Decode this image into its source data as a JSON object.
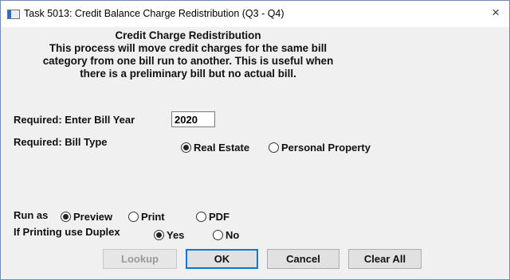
{
  "window": {
    "title": "Task 5013: Credit Balance Charge Redistribution (Q3 - Q4)",
    "close_glyph": "×",
    "icon": "app-window-icon"
  },
  "heading": {
    "title": "Credit Charge Redistribution",
    "lines": [
      "This process will move credit charges for the same bill",
      "category from one bill run to another.  This is useful when",
      "there is a preliminary bill but no actual bill."
    ]
  },
  "bill_year": {
    "label": "Required: Enter Bill Year",
    "value": "2020"
  },
  "bill_type": {
    "label": "Required: Bill Type",
    "options": [
      {
        "label": "Real Estate",
        "selected": true
      },
      {
        "label": "Personal Property",
        "selected": false
      }
    ]
  },
  "run_as": {
    "label": "Run as",
    "options": [
      {
        "label": "Preview",
        "selected": true
      },
      {
        "label": "Print",
        "selected": false
      },
      {
        "label": "PDF",
        "selected": false
      }
    ]
  },
  "duplex": {
    "label": "If Printing use Duplex",
    "options": [
      {
        "label": "Yes",
        "selected": true
      },
      {
        "label": "No",
        "selected": false
      }
    ]
  },
  "buttons": {
    "lookup": "Lookup",
    "ok": "OK",
    "cancel": "Cancel",
    "clear_all": "Clear All"
  },
  "colors": {
    "accent": "#0078d7",
    "dialog_bg": "#f0f0f0",
    "border": "#6c8fb5"
  }
}
